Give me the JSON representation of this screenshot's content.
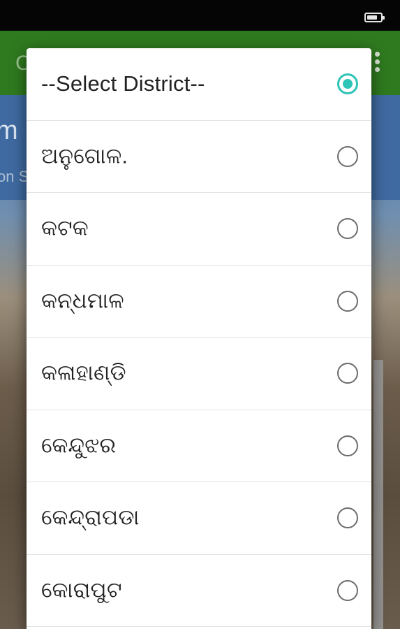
{
  "app_bar": {
    "title_fragment": "C"
  },
  "info_panel": {
    "big_fragment": "m",
    "small_fragment": "on S"
  },
  "dialog": {
    "options": [
      {
        "label": "--Select District--",
        "selected": true
      },
      {
        "label": "ଅନୁଗୋଳ.",
        "selected": false
      },
      {
        "label": "କଟକ",
        "selected": false
      },
      {
        "label": "କନ୍ଧମାଳ",
        "selected": false
      },
      {
        "label": "କଳାହାଣ୍ଡି",
        "selected": false
      },
      {
        "label": "କେନ୍ଦୁଝର",
        "selected": false
      },
      {
        "label": "କେନ୍ଦ୍ରାପଡା",
        "selected": false
      },
      {
        "label": "କୋରାପୁଟ",
        "selected": false
      }
    ],
    "accent_color": "#2ec4b6"
  },
  "colors": {
    "app_bar": "#2f7a1f",
    "status_bar": "#050505"
  }
}
